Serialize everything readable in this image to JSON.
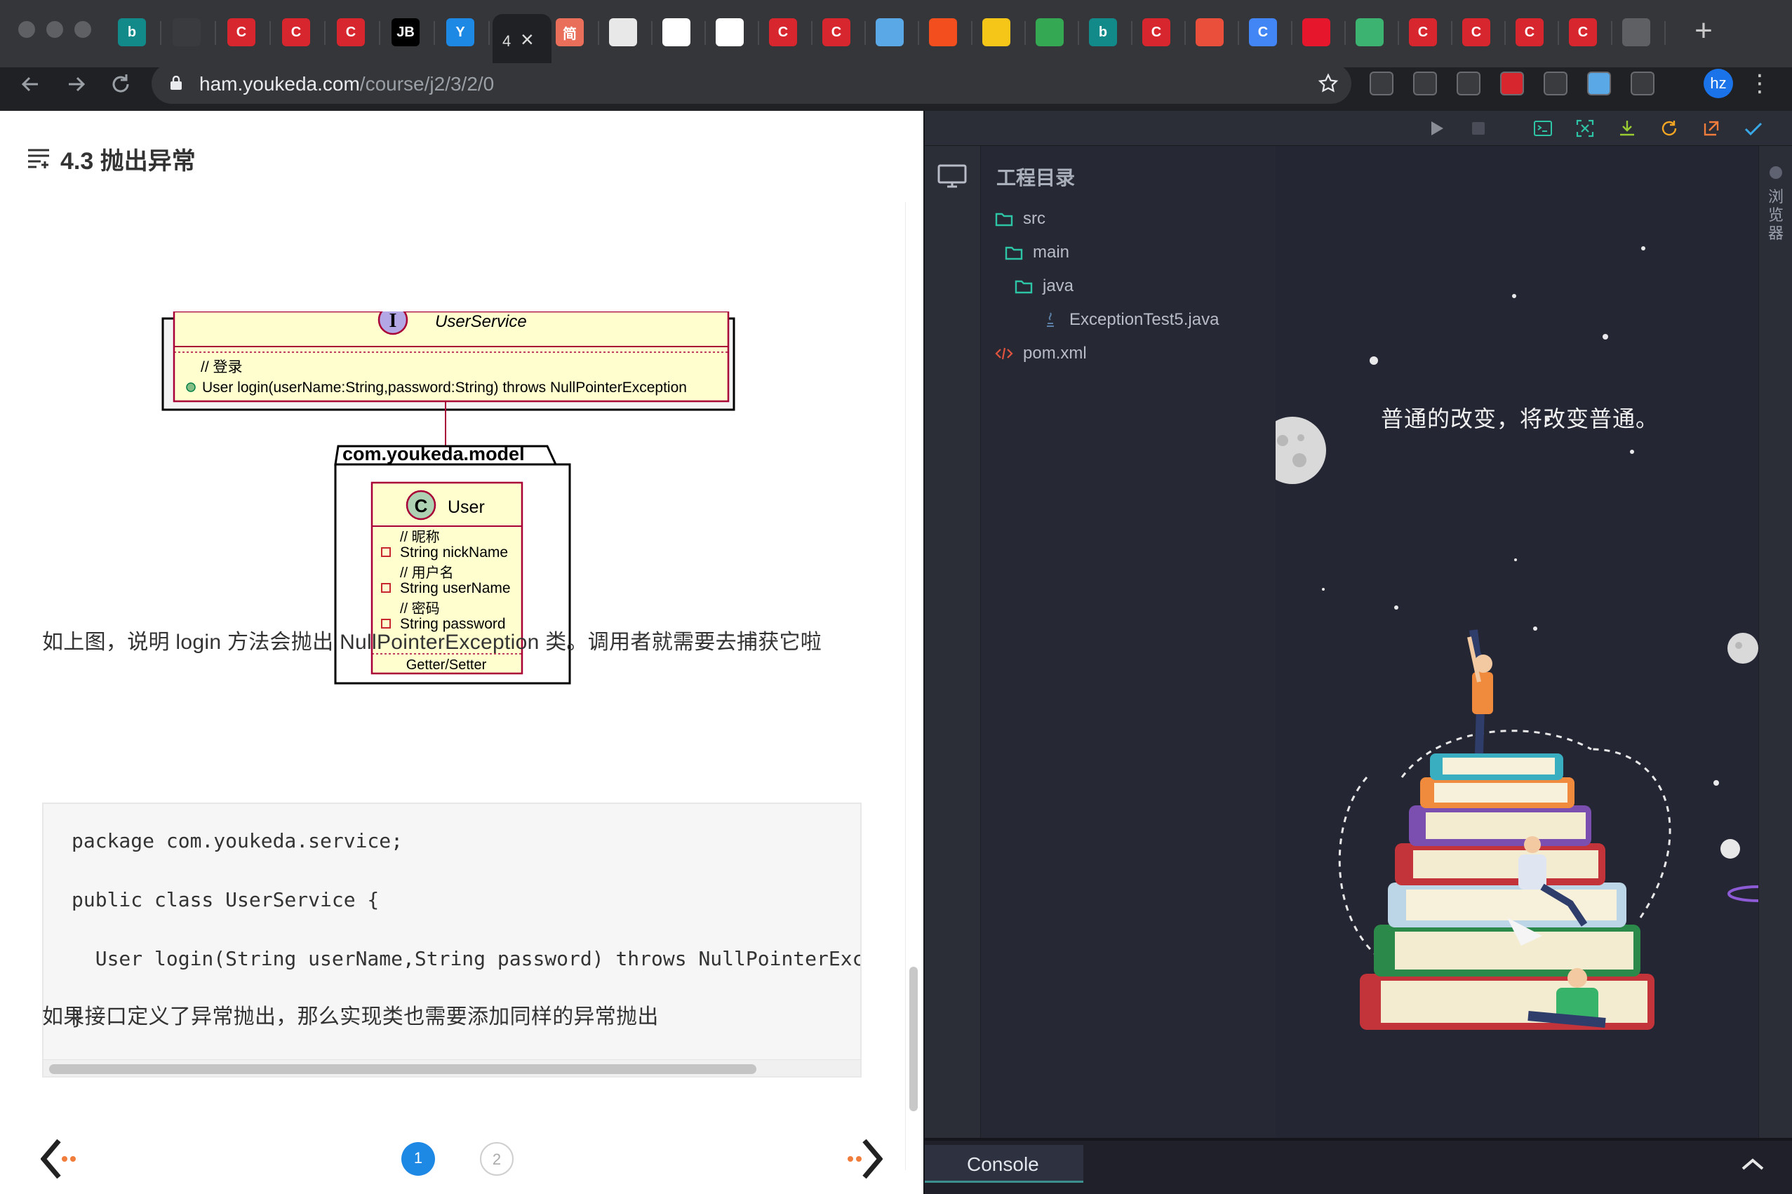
{
  "browser": {
    "tabs": [
      {
        "icon": "bing-icon",
        "label": "b",
        "color": "#138a8a"
      },
      {
        "icon": "dark-logo-icon",
        "label": "",
        "color": "#3a3b3f"
      },
      {
        "icon": "csdn-icon",
        "label": "C",
        "color": "#d7262e"
      },
      {
        "icon": "csdn-icon",
        "label": "C",
        "color": "#d7262e"
      },
      {
        "icon": "csdn-icon",
        "label": "C",
        "color": "#d7262e"
      },
      {
        "icon": "jetbrains-icon",
        "label": "JB",
        "color": "#000000"
      },
      {
        "icon": "yuque-icon",
        "label": "Y",
        "color": "#1e88e5"
      }
    ],
    "active_tab_title": "4",
    "tabs_after": [
      {
        "icon": "jianshu-icon",
        "label": "简",
        "color": "#ea6f5a"
      },
      {
        "icon": "scratch-icon",
        "label": "",
        "color": "#e8e8e8"
      },
      {
        "icon": "github-icon",
        "label": "",
        "color": "#ffffff"
      },
      {
        "icon": "github-icon",
        "label": "",
        "color": "#ffffff"
      },
      {
        "icon": "csdn-icon",
        "label": "C",
        "color": "#d7262e"
      },
      {
        "icon": "csdn-icon",
        "label": "C",
        "color": "#d7262e"
      },
      {
        "icon": "sketch-icon",
        "label": "",
        "color": "#5aa9e6"
      },
      {
        "icon": "figma-icon",
        "label": "",
        "color": "#f24e1e"
      },
      {
        "icon": "yandex-icon",
        "label": "",
        "color": "#f5c518"
      },
      {
        "icon": "chrome-icon",
        "label": "",
        "color": "#34a853"
      },
      {
        "icon": "bing-icon",
        "label": "b",
        "color": "#138a8a"
      },
      {
        "icon": "csdn-icon",
        "label": "C",
        "color": "#d7262e"
      },
      {
        "icon": "store-icon",
        "label": "",
        "color": "#e94f3a"
      },
      {
        "icon": "google-icon",
        "label": "C",
        "color": "#4285f4"
      },
      {
        "icon": "weibo-icon",
        "label": "",
        "color": "#e6162d"
      },
      {
        "icon": "map-icon",
        "label": "",
        "color": "#3cb371"
      },
      {
        "icon": "csdn-icon",
        "label": "C",
        "color": "#d7262e"
      },
      {
        "icon": "csdn-icon",
        "label": "C",
        "color": "#d7262e"
      },
      {
        "icon": "csdn-icon",
        "label": "C",
        "color": "#d7262e"
      },
      {
        "icon": "csdn-icon",
        "label": "C",
        "color": "#d7262e"
      },
      {
        "icon": "globe-icon",
        "label": "",
        "color": "#5f6064"
      }
    ],
    "url_host": "ham.youkeda.com",
    "url_path": "/course/j2/3/2/0",
    "profile_initials": "hz"
  },
  "lesson": {
    "title": "4.3 抛出异常",
    "uml": {
      "interface_name": "UserService",
      "interface_comment": "// 登录",
      "interface_method": "User login(userName:String,password:String) throws NullPointerException",
      "package_name": "com.youkeda.model",
      "class_name": "User",
      "fields": [
        {
          "comment": "// 昵称",
          "field": "String nickName"
        },
        {
          "comment": "// 用户名",
          "field": "String userName"
        },
        {
          "comment": "// 密码",
          "field": "String password"
        }
      ],
      "methods_label": "Getter/Setter",
      "interface_badge": "I",
      "class_badge": "C"
    },
    "paragraph1": "如上图，说明 login 方法会抛出 NullPointerException 类。调用者就需要去捕获它啦",
    "code_lines": [
      "package com.youkeda.service;",
      "public class UserService {",
      "  User login(String userName,String password) throws NullPointerExc",
      "}"
    ],
    "paragraph2": "如果接口定义了异常抛出，那么实现类也需要添加同样的异常抛出",
    "pages": [
      "1",
      "2"
    ],
    "current_page": "1"
  },
  "ide": {
    "explorer_title": "工程目录",
    "tree": [
      {
        "label": "src",
        "type": "folder",
        "depth": 0
      },
      {
        "label": "main",
        "type": "folder",
        "depth": 1
      },
      {
        "label": "java",
        "type": "folder",
        "depth": 2
      },
      {
        "label": "ExceptionTest5.java",
        "type": "java-file",
        "depth": 3
      },
      {
        "label": "pom.xml",
        "type": "xml-file",
        "depth": 0
      }
    ],
    "slogan": "普通的改变，将改变普通。",
    "browser_tab": "浏览器",
    "console_label": "Console",
    "colors": {
      "accent": "#3c8f8f",
      "run": "#8a8d95",
      "tool_green": "#2ec4a6",
      "tool_orange": "#f5a623"
    }
  }
}
